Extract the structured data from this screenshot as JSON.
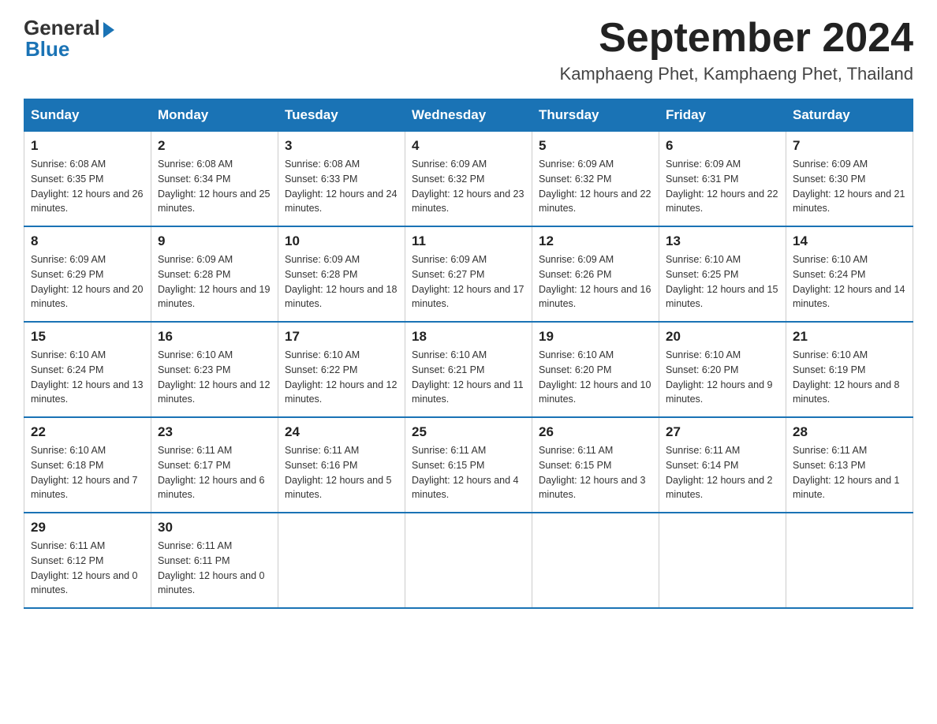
{
  "logo": {
    "general": "General",
    "blue": "Blue"
  },
  "title": "September 2024",
  "location": "Kamphaeng Phet, Kamphaeng Phet, Thailand",
  "weekdays": [
    "Sunday",
    "Monday",
    "Tuesday",
    "Wednesday",
    "Thursday",
    "Friday",
    "Saturday"
  ],
  "weeks": [
    [
      {
        "day": "1",
        "sunrise": "6:08 AM",
        "sunset": "6:35 PM",
        "daylight": "12 hours and 26 minutes."
      },
      {
        "day": "2",
        "sunrise": "6:08 AM",
        "sunset": "6:34 PM",
        "daylight": "12 hours and 25 minutes."
      },
      {
        "day": "3",
        "sunrise": "6:08 AM",
        "sunset": "6:33 PM",
        "daylight": "12 hours and 24 minutes."
      },
      {
        "day": "4",
        "sunrise": "6:09 AM",
        "sunset": "6:32 PM",
        "daylight": "12 hours and 23 minutes."
      },
      {
        "day": "5",
        "sunrise": "6:09 AM",
        "sunset": "6:32 PM",
        "daylight": "12 hours and 22 minutes."
      },
      {
        "day": "6",
        "sunrise": "6:09 AM",
        "sunset": "6:31 PM",
        "daylight": "12 hours and 22 minutes."
      },
      {
        "day": "7",
        "sunrise": "6:09 AM",
        "sunset": "6:30 PM",
        "daylight": "12 hours and 21 minutes."
      }
    ],
    [
      {
        "day": "8",
        "sunrise": "6:09 AM",
        "sunset": "6:29 PM",
        "daylight": "12 hours and 20 minutes."
      },
      {
        "day": "9",
        "sunrise": "6:09 AM",
        "sunset": "6:28 PM",
        "daylight": "12 hours and 19 minutes."
      },
      {
        "day": "10",
        "sunrise": "6:09 AM",
        "sunset": "6:28 PM",
        "daylight": "12 hours and 18 minutes."
      },
      {
        "day": "11",
        "sunrise": "6:09 AM",
        "sunset": "6:27 PM",
        "daylight": "12 hours and 17 minutes."
      },
      {
        "day": "12",
        "sunrise": "6:09 AM",
        "sunset": "6:26 PM",
        "daylight": "12 hours and 16 minutes."
      },
      {
        "day": "13",
        "sunrise": "6:10 AM",
        "sunset": "6:25 PM",
        "daylight": "12 hours and 15 minutes."
      },
      {
        "day": "14",
        "sunrise": "6:10 AM",
        "sunset": "6:24 PM",
        "daylight": "12 hours and 14 minutes."
      }
    ],
    [
      {
        "day": "15",
        "sunrise": "6:10 AM",
        "sunset": "6:24 PM",
        "daylight": "12 hours and 13 minutes."
      },
      {
        "day": "16",
        "sunrise": "6:10 AM",
        "sunset": "6:23 PM",
        "daylight": "12 hours and 12 minutes."
      },
      {
        "day": "17",
        "sunrise": "6:10 AM",
        "sunset": "6:22 PM",
        "daylight": "12 hours and 12 minutes."
      },
      {
        "day": "18",
        "sunrise": "6:10 AM",
        "sunset": "6:21 PM",
        "daylight": "12 hours and 11 minutes."
      },
      {
        "day": "19",
        "sunrise": "6:10 AM",
        "sunset": "6:20 PM",
        "daylight": "12 hours and 10 minutes."
      },
      {
        "day": "20",
        "sunrise": "6:10 AM",
        "sunset": "6:20 PM",
        "daylight": "12 hours and 9 minutes."
      },
      {
        "day": "21",
        "sunrise": "6:10 AM",
        "sunset": "6:19 PM",
        "daylight": "12 hours and 8 minutes."
      }
    ],
    [
      {
        "day": "22",
        "sunrise": "6:10 AM",
        "sunset": "6:18 PM",
        "daylight": "12 hours and 7 minutes."
      },
      {
        "day": "23",
        "sunrise": "6:11 AM",
        "sunset": "6:17 PM",
        "daylight": "12 hours and 6 minutes."
      },
      {
        "day": "24",
        "sunrise": "6:11 AM",
        "sunset": "6:16 PM",
        "daylight": "12 hours and 5 minutes."
      },
      {
        "day": "25",
        "sunrise": "6:11 AM",
        "sunset": "6:15 PM",
        "daylight": "12 hours and 4 minutes."
      },
      {
        "day": "26",
        "sunrise": "6:11 AM",
        "sunset": "6:15 PM",
        "daylight": "12 hours and 3 minutes."
      },
      {
        "day": "27",
        "sunrise": "6:11 AM",
        "sunset": "6:14 PM",
        "daylight": "12 hours and 2 minutes."
      },
      {
        "day": "28",
        "sunrise": "6:11 AM",
        "sunset": "6:13 PM",
        "daylight": "12 hours and 1 minute."
      }
    ],
    [
      {
        "day": "29",
        "sunrise": "6:11 AM",
        "sunset": "6:12 PM",
        "daylight": "12 hours and 0 minutes."
      },
      {
        "day": "30",
        "sunrise": "6:11 AM",
        "sunset": "6:11 PM",
        "daylight": "12 hours and 0 minutes."
      },
      null,
      null,
      null,
      null,
      null
    ]
  ]
}
